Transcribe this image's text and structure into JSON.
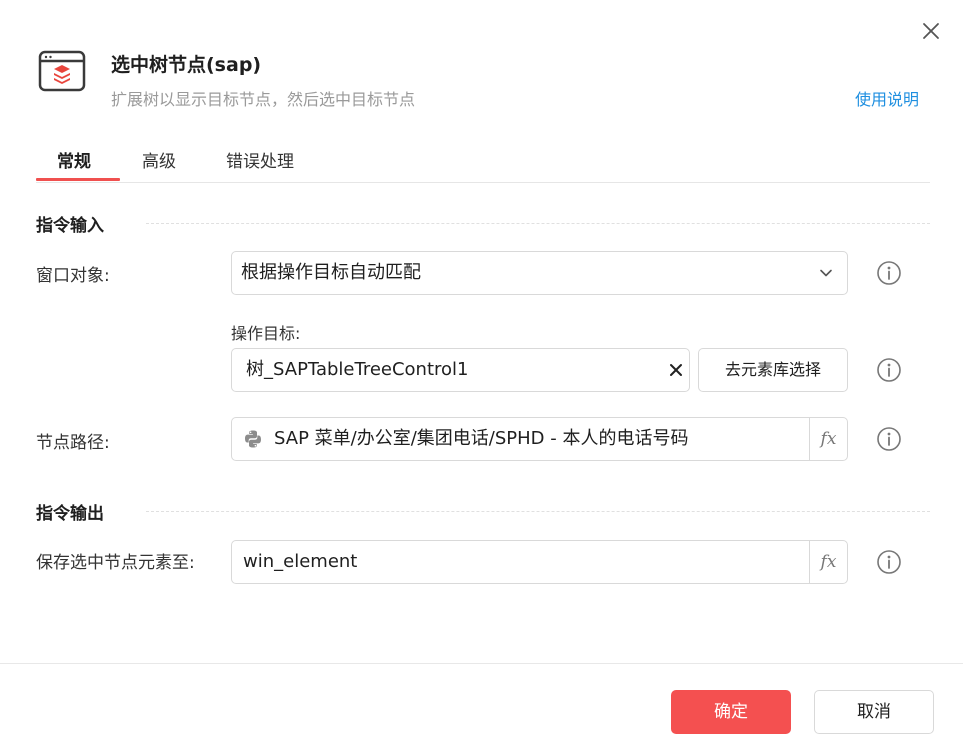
{
  "dialog": {
    "title": "选中树节点(sap)",
    "subtitle": "扩展树以显示目标节点，然后选中目标节点",
    "help_link": "使用说明",
    "close_icon": "close-icon",
    "header_icon": "window-sap-icon"
  },
  "tabs": [
    {
      "label": "常规",
      "active": true
    },
    {
      "label": "高级",
      "active": false
    },
    {
      "label": "错误处理",
      "active": false
    }
  ],
  "input_section": {
    "title": "指令输入",
    "window_object": {
      "label": "窗口对象:",
      "value": "根据操作目标自动匹配"
    },
    "target": {
      "label": "操作目标:",
      "value": "树_SAPTableTreeControl1",
      "select_button": "去元素库选择"
    },
    "node_path": {
      "label": "节点路径:",
      "value": "SAP 菜单/办公室/集团电话/SPHD - 本人的电话号码"
    }
  },
  "output_section": {
    "title": "指令输出",
    "save_to": {
      "label": "保存选中节点元素至:",
      "value": "win_element"
    }
  },
  "fx_label": "fx",
  "footer": {
    "ok": "确定",
    "cancel": "取消"
  },
  "colors": {
    "accent": "#f45050",
    "link": "#1f8fe0",
    "icon_red": "#e8453c"
  }
}
